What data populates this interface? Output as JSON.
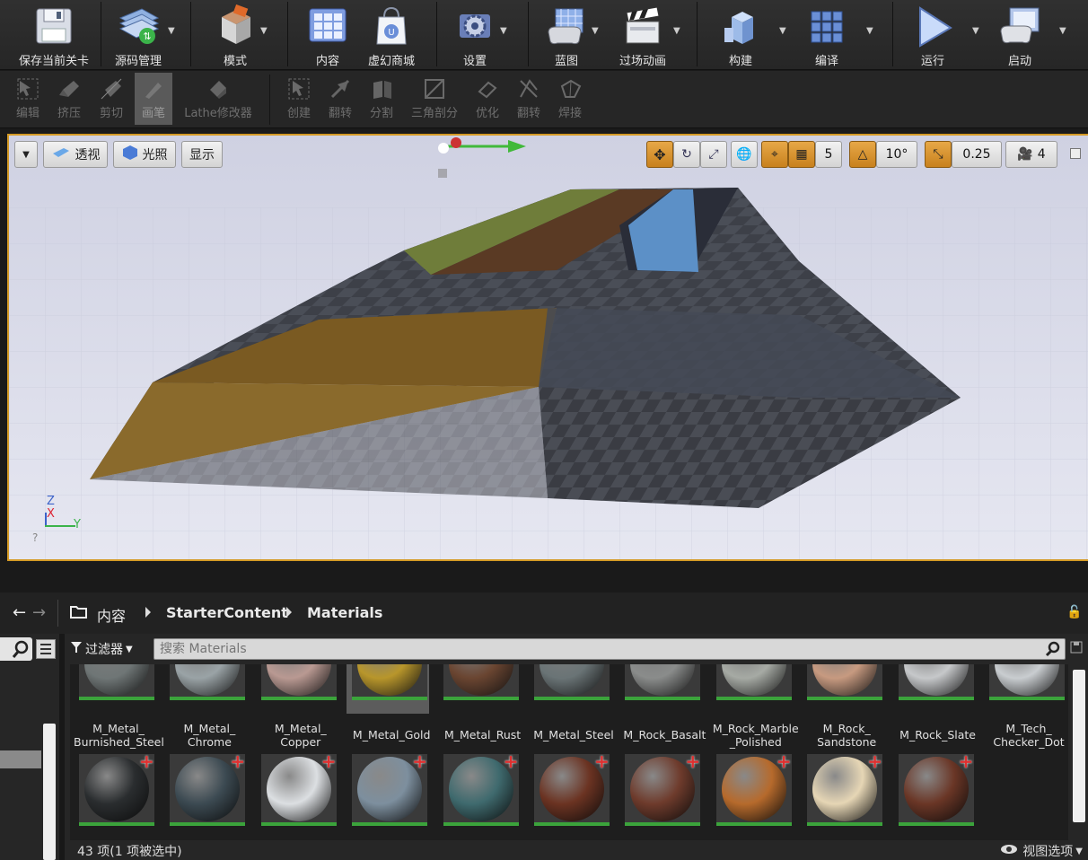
{
  "toolbar": {
    "buttons": [
      {
        "label": "保存当前关卡",
        "icon": "save-icon"
      },
      {
        "label": "源码管理",
        "icon": "source-control-icon"
      },
      {
        "label": "模式",
        "icon": "modes-icon"
      },
      {
        "label": "内容",
        "icon": "content-icon"
      },
      {
        "label": "虚幻商城",
        "icon": "marketplace-icon"
      },
      {
        "label": "设置",
        "icon": "settings-icon"
      },
      {
        "label": "蓝图",
        "icon": "blueprints-icon"
      },
      {
        "label": "过场动画",
        "icon": "cinematics-icon"
      },
      {
        "label": "构建",
        "icon": "build-icon"
      },
      {
        "label": "编译",
        "icon": "compile-icon"
      },
      {
        "label": "运行",
        "icon": "play-icon"
      },
      {
        "label": "启动",
        "icon": "launch-icon"
      }
    ]
  },
  "geometry_tools": {
    "items": [
      {
        "label": "编辑",
        "icon": "edit-icon"
      },
      {
        "label": "挤压",
        "icon": "extrude-icon"
      },
      {
        "label": "剪切",
        "icon": "clip-icon"
      },
      {
        "label": "画笔",
        "icon": "pen-icon",
        "active": true
      },
      {
        "label": "Lathe修改器",
        "icon": "lathe-icon"
      },
      {
        "label": "创建",
        "icon": "create-icon"
      },
      {
        "label": "翻转",
        "icon": "flip-icon"
      },
      {
        "label": "分割",
        "icon": "split-icon"
      },
      {
        "label": "三角剖分",
        "icon": "triangulate-icon"
      },
      {
        "label": "优化",
        "icon": "optimize-icon"
      },
      {
        "label": "翻转",
        "icon": "turn-icon"
      },
      {
        "label": "焊接",
        "icon": "weld-icon"
      }
    ]
  },
  "viewport": {
    "perspective_label": "透视",
    "lighting_label": "光照",
    "show_label": "显示",
    "grid_snap": "5",
    "rotation_snap": "10°",
    "scale_snap": "0.25",
    "camera_speed": "4",
    "axis_z": "Z",
    "axis_x": "X",
    "axis_y": "Y",
    "accent_color": "#d49a25"
  },
  "content_browser": {
    "breadcrumb": [
      "内容",
      "StarterContent",
      "Materials"
    ],
    "filter_label": "过滤器",
    "search_placeholder": "搜索 Materials",
    "status": "43 项(1 项被选中)",
    "view_options": "视图选项",
    "row1": [
      {
        "name": "M_Metal_\nBurnished_Steel",
        "color": "#6f7676"
      },
      {
        "name": "M_Metal_\nChrome",
        "color": "#9aa3a6"
      },
      {
        "name": "M_Metal_\nCopper",
        "color": "#b99992"
      },
      {
        "name": "M_Metal_Gold",
        "color": "#b8962b",
        "selected": true
      },
      {
        "name": "M_Metal_Rust",
        "color": "#6a4531"
      },
      {
        "name": "M_Metal_Steel",
        "color": "#6a7476"
      },
      {
        "name": "M_Rock_Basalt",
        "color": "#8a8c8b"
      },
      {
        "name": "M_Rock_Marble\n_Polished",
        "color": "#a6aaa4"
      },
      {
        "name": "M_Rock_\nSandstone",
        "color": "#c79a80"
      },
      {
        "name": "M_Rock_Slate",
        "color": "#c6c8ca"
      },
      {
        "name": "M_Tech_\nChecker_Dot",
        "color": "#c9cdd0"
      }
    ],
    "row2": [
      {
        "color": "#2a2d2f",
        "plus": true
      },
      {
        "color": "#3c4a52",
        "plus": true
      },
      {
        "color": "#dcdfe2",
        "plus": true
      },
      {
        "color": "#7d8f9e",
        "plus": true
      },
      {
        "color": "#3f6a6e",
        "plus": true
      },
      {
        "color": "#6b3322",
        "plus": true
      },
      {
        "color": "#6e3b2c",
        "plus": true
      },
      {
        "color": "#b66a2c",
        "plus": true
      },
      {
        "color": "#e6d6b5",
        "plus": true
      },
      {
        "color": "#6a3626",
        "plus": true
      }
    ]
  }
}
